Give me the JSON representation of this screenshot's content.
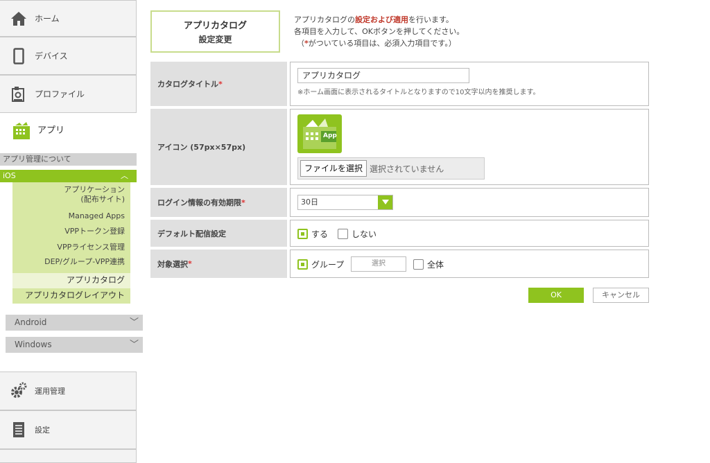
{
  "sidebar": {
    "nav": [
      {
        "label": "ホーム",
        "icon": "home-icon"
      },
      {
        "label": "デバイス",
        "icon": "device-icon"
      },
      {
        "label": "プロファイル",
        "icon": "profile-icon"
      },
      {
        "label": "アプリ",
        "icon": "app-icon"
      },
      {
        "label": "運用管理",
        "icon": "gear-icon"
      },
      {
        "label": "設定",
        "icon": "settings-doc-icon"
      }
    ],
    "about_label": "アプリ管理について",
    "ios": {
      "label": "iOS",
      "items": [
        {
          "label": "アプリケーション\n(配布サイト)"
        },
        {
          "label": "Managed Apps"
        },
        {
          "label": "VPPトークン登録"
        },
        {
          "label": "VPPライセンス管理"
        },
        {
          "label": "DEP/グループ-VPP連携"
        },
        {
          "label": "アプリカタログ"
        },
        {
          "label": "アプリカタログレイアウト"
        }
      ]
    },
    "android_label": "Android",
    "windows_label": "Windows"
  },
  "header": {
    "title_line1": "アプリカタログ",
    "title_line2": "設定変更",
    "intro_line1_pre": "アプリカタログの",
    "intro_line1_em": "設定および適用",
    "intro_line1_post": "を行います。",
    "intro_line2": "各項目を入力して、OKボタンを押してください。",
    "intro_line3_pre": "（",
    "intro_line3_star": "*",
    "intro_line3_post": "がついている項目は、必須入力項目です。）"
  },
  "form": {
    "catalog_title": {
      "label": "カタログタイトル",
      "required": "*",
      "value": "アプリカタログ",
      "note": "※ホーム画面に表示されるタイトルとなりますので10文字以内を推奨します。"
    },
    "icon": {
      "label": "アイコン (57px×57px)",
      "preview_text": "App",
      "file_button": "ファイルを選択",
      "file_status": "選択されていません"
    },
    "login_expiry": {
      "label": "ログイン情報の有効期限",
      "required": "*",
      "value": "30日"
    },
    "default_delivery": {
      "label": "デフォルト配信設定",
      "option_on": "する",
      "option_off": "しない",
      "selected": "する"
    },
    "target": {
      "label": "対象選択",
      "required": "*",
      "option_group": "グループ",
      "select_button": "選択",
      "option_all": "全体",
      "selected": "グループ"
    }
  },
  "actions": {
    "ok_label": "OK",
    "cancel_label": "キャンセル"
  },
  "colors": {
    "accent": "#8fc31f",
    "submenu_bg": "#d8e8a4",
    "label_bg": "#e0e0e0",
    "required": "#d33"
  }
}
